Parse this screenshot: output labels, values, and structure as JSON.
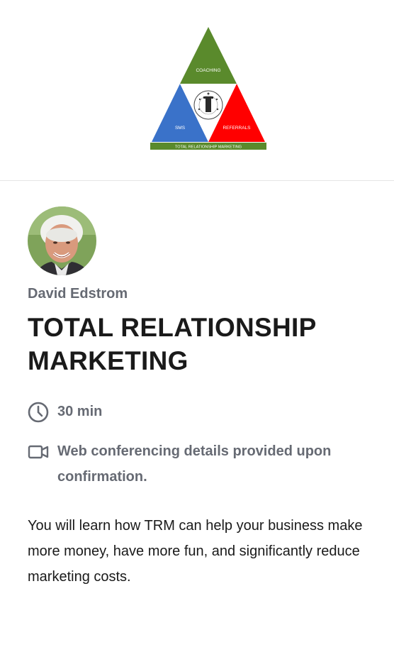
{
  "logo": {
    "top_label": "COACHING",
    "left_label": "SMS",
    "right_label": "REFERRALS",
    "banner_text": "TOTAL RELATIONSHIP MARKETING",
    "seal_text": "THE MILLION DOLLAR FORMULA SERVICES",
    "colors": {
      "top": "#5a8a2c",
      "left": "#3a72c9",
      "right": "#ff0000",
      "banner": "#5a8a2c"
    }
  },
  "host": {
    "name": "David Edstrom"
  },
  "event": {
    "title": "TOTAL RELATIONSHIP MARKETING",
    "duration": "30 min",
    "location": "Web conferencing details provided upon confirmation.",
    "description": "You will learn how TRM can help your business make more money, have more fun, and significantly reduce marketing costs."
  },
  "icons": {
    "duration": "clock-icon",
    "location": "video-camera-icon"
  }
}
